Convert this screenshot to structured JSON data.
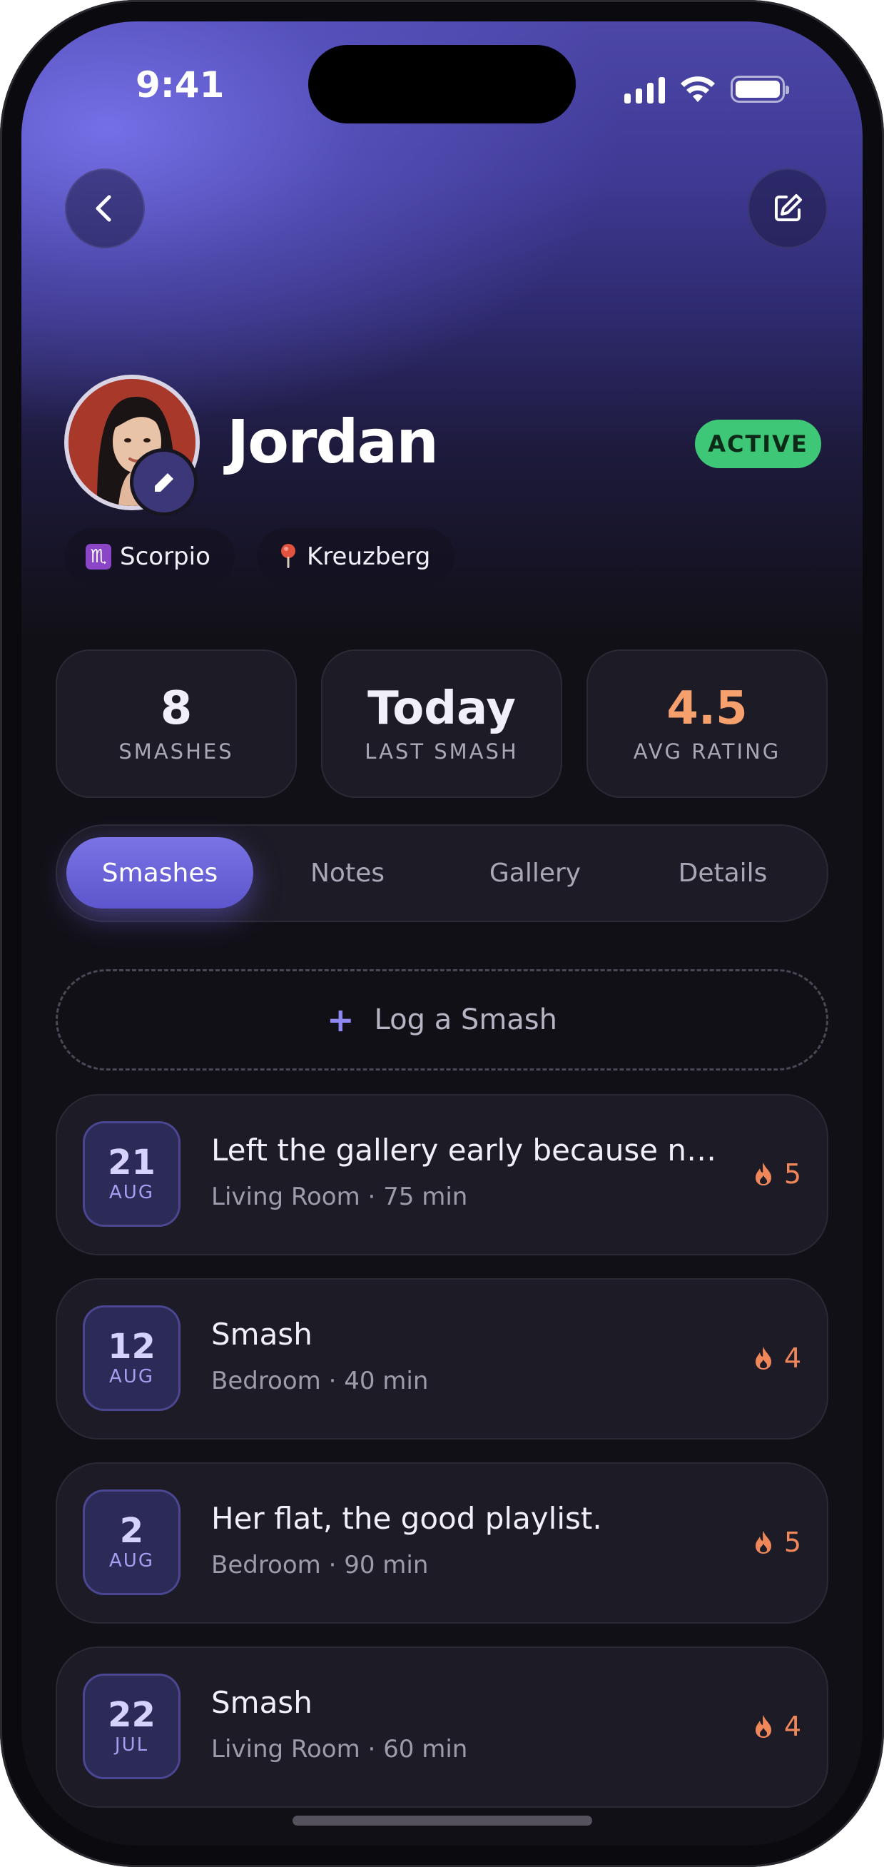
{
  "status_bar": {
    "time": "9:41"
  },
  "profile": {
    "name": "Jordan",
    "status": "ACTIVE",
    "zodiac_glyph": "♏",
    "zodiac": "Scorpio",
    "location": "Kreuzberg"
  },
  "stats": [
    {
      "value": "8",
      "label": "SMASHES",
      "color": "#f1eff8"
    },
    {
      "value": "Today",
      "label": "LAST SMASH",
      "color": "#f1eff8"
    },
    {
      "value": "4.5",
      "label": "AVG RATING",
      "color": "#f6a06e"
    }
  ],
  "tabs": [
    {
      "label": "Smashes",
      "active": true
    },
    {
      "label": "Notes",
      "active": false
    },
    {
      "label": "Gallery",
      "active": false
    },
    {
      "label": "Details",
      "active": false
    }
  ],
  "log_button": {
    "icon": "+",
    "label": "Log a Smash"
  },
  "smashes": [
    {
      "day": "21",
      "month": "AUG",
      "title": "Left the gallery early because nei...",
      "meta": "Living Room · 75 min",
      "rating": "5"
    },
    {
      "day": "12",
      "month": "AUG",
      "title": "Smash",
      "meta": "Bedroom · 40 min",
      "rating": "4"
    },
    {
      "day": "2",
      "month": "AUG",
      "title": "Her flat, the good playlist.",
      "meta": "Bedroom · 90 min",
      "rating": "5"
    },
    {
      "day": "22",
      "month": "JUL",
      "title": "Smash",
      "meta": "Living Room · 60 min",
      "rating": "4"
    }
  ],
  "colors": {
    "accent": "#6e66e0",
    "active_badge": "#3ec776",
    "rating": "#f0875a",
    "background": "#121017"
  },
  "icons": {
    "back": "chevron-left-icon",
    "edit": "edit-icon",
    "avatar_edit": "pencil-icon",
    "location": "pin-icon",
    "rating": "flame-icon"
  }
}
